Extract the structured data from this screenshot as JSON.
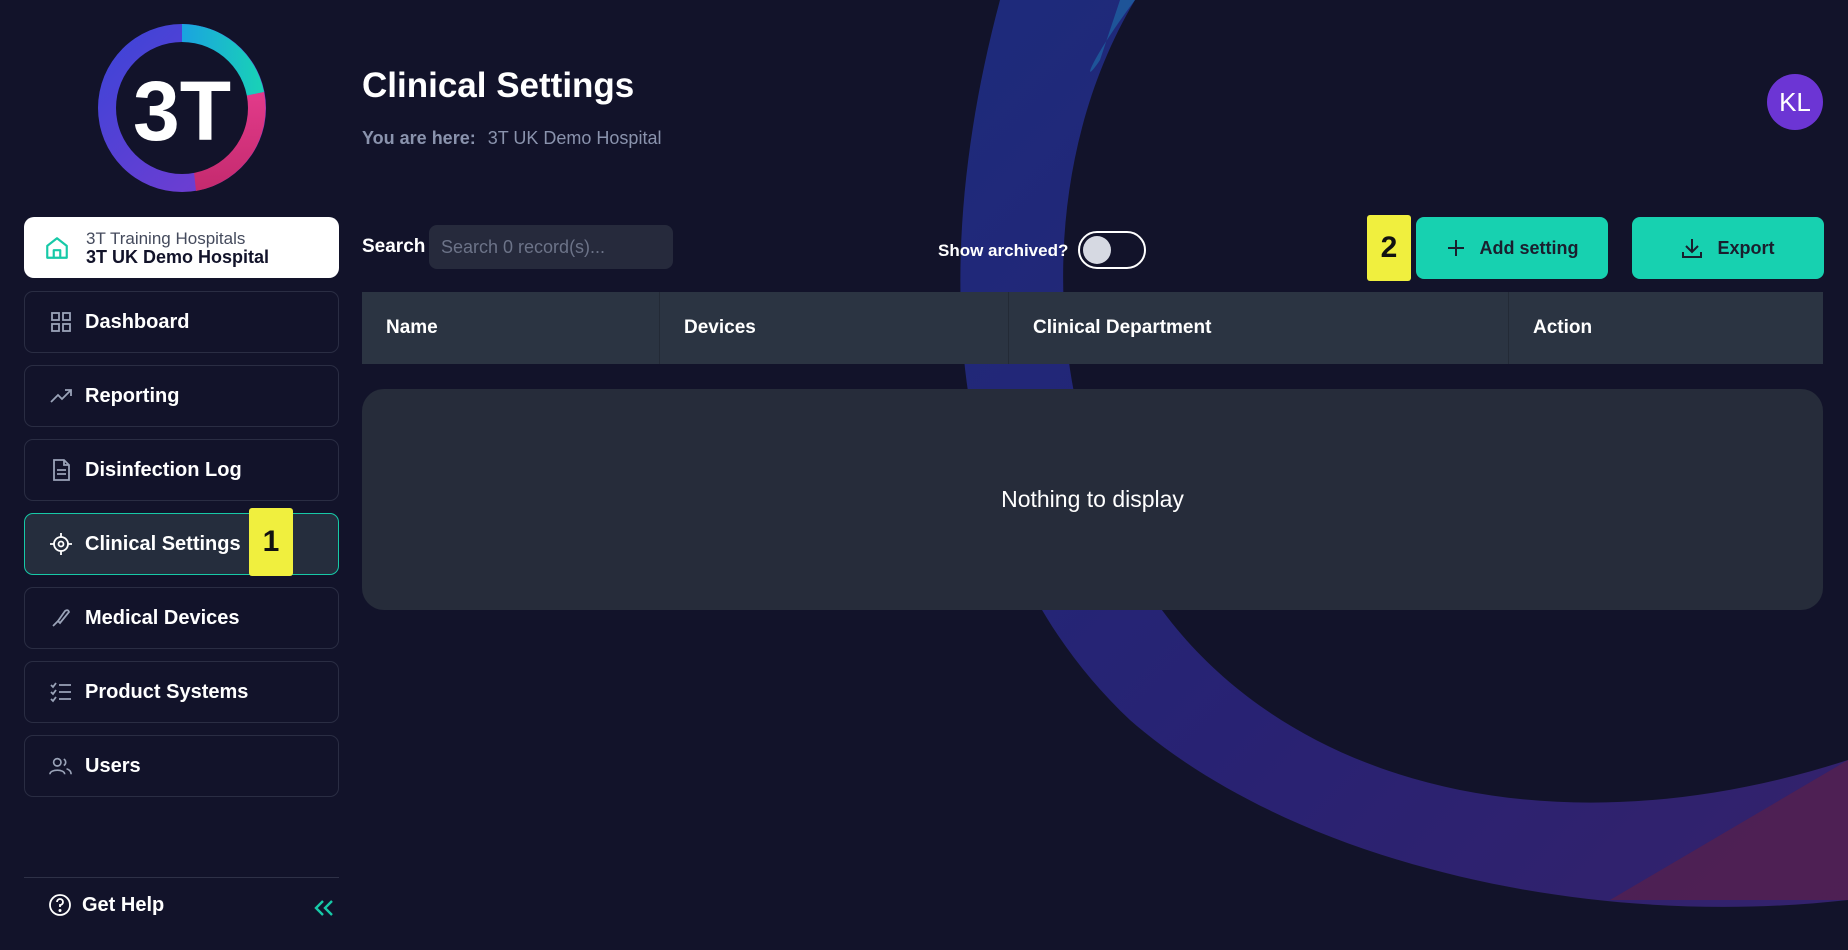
{
  "app": {
    "logo_text": "3T"
  },
  "org": {
    "parent": "3T Training Hospitals",
    "name": "3T UK Demo Hospital"
  },
  "sidebar": {
    "items": [
      {
        "label": "Dashboard",
        "icon": "grid-icon"
      },
      {
        "label": "Reporting",
        "icon": "trend-icon"
      },
      {
        "label": "Disinfection Log",
        "icon": "document-icon"
      },
      {
        "label": "Clinical Settings",
        "icon": "target-icon",
        "active": true
      },
      {
        "label": "Medical Devices",
        "icon": "probe-icon"
      },
      {
        "label": "Product Systems",
        "icon": "checklist-icon"
      },
      {
        "label": "Users",
        "icon": "users-icon"
      }
    ],
    "help_label": "Get Help"
  },
  "markers": {
    "one": "1",
    "two": "2"
  },
  "header": {
    "title": "Clinical Settings",
    "breadcrumb_label": "You are here:",
    "breadcrumb_value": "3T UK Demo Hospital",
    "avatar_initials": "KL"
  },
  "toolbar": {
    "search_label": "Search",
    "search_placeholder": "Search 0 record(s)...",
    "archived_label": "Show archived?",
    "archived_on": false,
    "add_label": "Add setting",
    "export_label": "Export"
  },
  "table": {
    "columns": [
      "Name",
      "Devices",
      "Clinical Department",
      "Action"
    ],
    "empty_text": "Nothing to display"
  },
  "colors": {
    "accent": "#17d1b0",
    "background": "#12132a",
    "avatar": "#6c35d4",
    "marker": "#f0ef3e"
  }
}
